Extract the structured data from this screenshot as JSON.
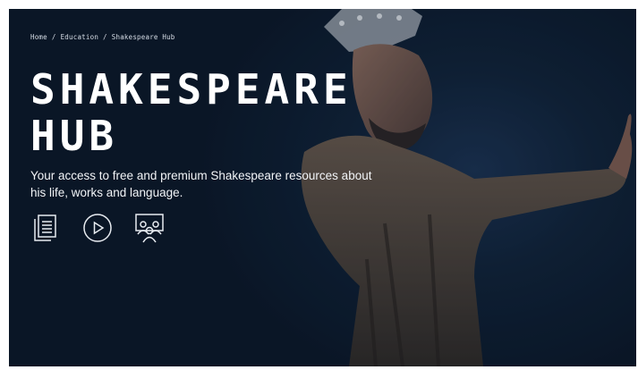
{
  "breadcrumb": [
    "Home",
    "Education",
    "Shakespeare Hub"
  ],
  "breadcrumb_separator": "/",
  "hero": {
    "title_line1": "SHAKESPEARE",
    "title_line2": "HUB",
    "description": "Your access to free and premium Shakespeare resources about his life, works and language."
  },
  "resource_icons": [
    "document-icon",
    "play-icon",
    "audience-icon"
  ],
  "colors": {
    "background": "#0f2136",
    "text": "#ffffff"
  }
}
